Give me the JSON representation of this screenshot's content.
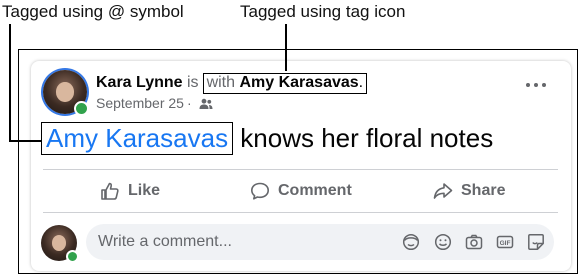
{
  "callouts": {
    "at_symbol": "Tagged using @ symbol",
    "tag_icon": "Tagged using tag icon"
  },
  "post": {
    "author": "Kara Lynne",
    "is_text": "is",
    "with_text": "with",
    "tagged_person": "Amy Karasavas",
    "period": ".",
    "date": "September 25",
    "separator": "·",
    "audience_icon": "friends-icon",
    "mention": "Amy Karasavas",
    "text_after_mention": " knows her floral notes"
  },
  "actions": {
    "like": "Like",
    "comment": "Comment",
    "share": "Share"
  },
  "comment_box": {
    "placeholder": "Write a comment...",
    "icons": [
      "avatar-sticker-icon",
      "emoji-icon",
      "camera-icon",
      "gif-icon",
      "sticker-icon"
    ]
  },
  "colors": {
    "mention_blue": "#1877f2",
    "online_green": "#31a24c",
    "secondary_text": "#65676b"
  }
}
